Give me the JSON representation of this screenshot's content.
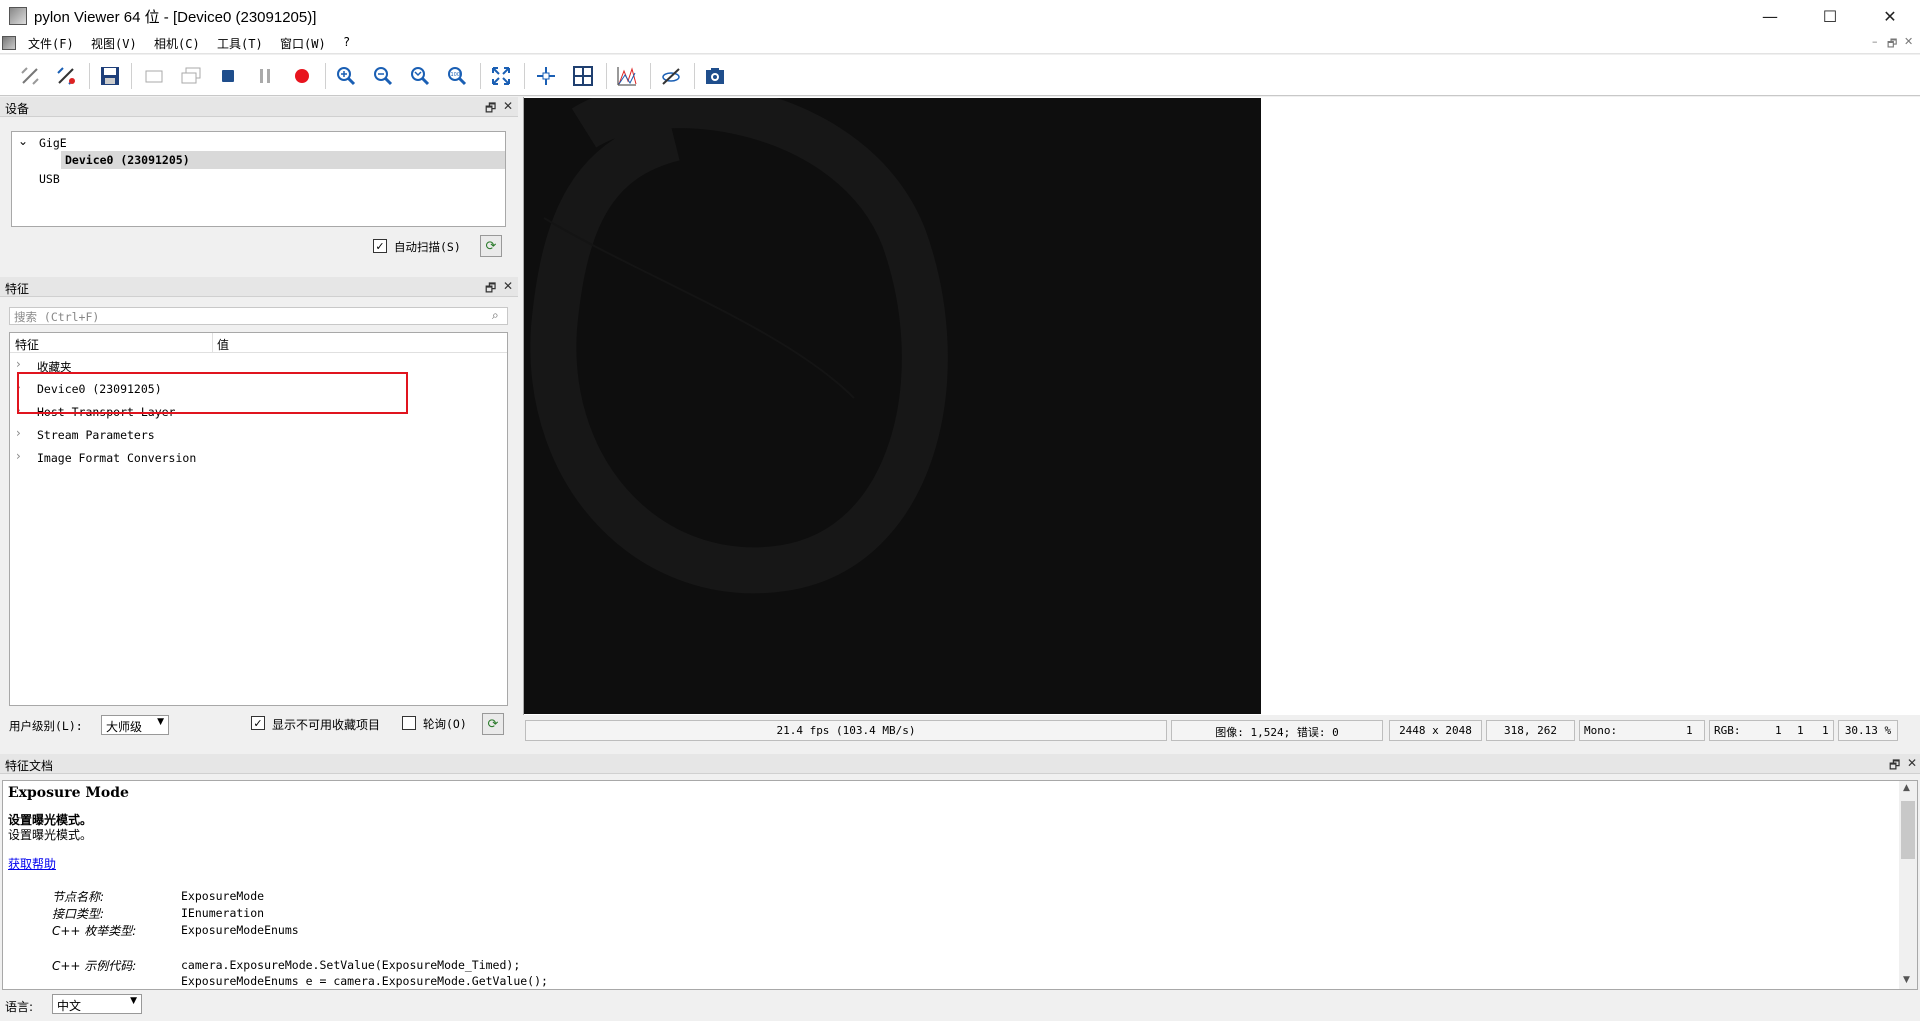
{
  "window": {
    "title": "pylon Viewer 64 位 - [Device0 (23091205)]",
    "minimize_glyph": "—",
    "maximize_glyph": "☐",
    "close_glyph": "✕"
  },
  "menu": {
    "items": [
      {
        "label": "文件(F)"
      },
      {
        "label": "视图(V)"
      },
      {
        "label": "相机(C)"
      },
      {
        "label": "工具(T)"
      },
      {
        "label": "窗口(W)"
      },
      {
        "label": "?"
      }
    ],
    "mdi_min": "–",
    "mdi_restore": "🗗",
    "mdi_close": "✕"
  },
  "toolbar": {
    "icons": [
      "disconnect-icon",
      "reconnect-icon",
      "save-icon",
      "single-shot-icon",
      "continuous-shot-icon",
      "stop-icon",
      "pause-icon",
      "record-icon",
      "zoom-in-icon",
      "zoom-out-icon",
      "zoom-fit-icon",
      "zoom-100-icon",
      "fullscreen-icon",
      "crosshair-icon",
      "grid-icon",
      "histogram-icon",
      "pixel-hide-icon",
      "screenshot-icon"
    ]
  },
  "devices_panel": {
    "title": "设备",
    "tree": [
      {
        "label": "GigE",
        "expanded": true
      },
      {
        "label": "Device0 (23091205)",
        "selected": true
      },
      {
        "label": "USB"
      }
    ],
    "auto_scan_label": "自动扫描(S)",
    "auto_scan_checked": true
  },
  "features_panel": {
    "title": "特征",
    "search_placeholder": "搜索 (Ctrl+F)",
    "col_feature": "特征",
    "col_value": "值",
    "items": [
      {
        "label": "收藏夹"
      },
      {
        "label": "Device0 (23091205)"
      },
      {
        "label": "Host Transport Layer"
      },
      {
        "label": "Stream Parameters"
      },
      {
        "label": "Image Format Conversion"
      }
    ],
    "user_level_label": "用户级别(L):",
    "user_level_value": "大师级",
    "show_unavailable_label": "显示不可用收藏项目",
    "show_unavailable_checked": true,
    "polling_label": "轮询(O)",
    "polling_checked": false
  },
  "status": {
    "fps": "21.4 fps (103.4 MB/s)",
    "images": "图像: 1,524; 错误: 0",
    "resolution": "2448 x 2048",
    "cursor": "318,  262",
    "mono_label": "Mono:",
    "mono_value": "1",
    "rgb_label": "RGB:",
    "rgb_values": [
      "1",
      "1",
      "1"
    ],
    "zoom": "30.13 %"
  },
  "doc_panel": {
    "title": "特征文档",
    "heading": "Exposure Mode",
    "summary_bold": "设置曝光模式。",
    "summary": "设置曝光模式。",
    "help_link": "获取帮助",
    "rows": [
      {
        "k": "节点名称:",
        "v": "ExposureMode"
      },
      {
        "k": "接口类型:",
        "v": "IEnumeration"
      },
      {
        "k": "C++ 枚举类型:",
        "v": "ExposureModeEnums"
      }
    ],
    "example_label": "C++ 示例代码:",
    "example_lines": [
      "camera.ExposureMode.SetValue(ExposureMode_Timed);",
      "ExposureModeEnums e = camera.ExposureMode.GetValue();"
    ]
  },
  "language": {
    "label": "语言:",
    "value": "中文"
  },
  "colors": {
    "highlight_box": "#e0141e",
    "record": "#e8141e",
    "link": "#0000ee"
  }
}
